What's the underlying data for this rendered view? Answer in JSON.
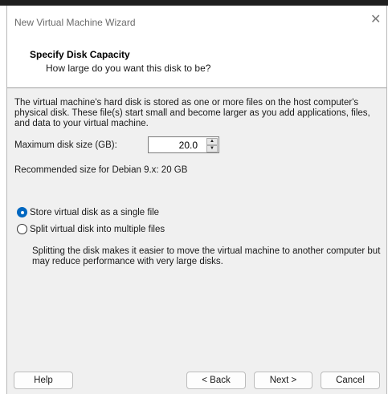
{
  "window": {
    "title": "New Virtual Machine Wizard",
    "close_glyph": "✕"
  },
  "header": {
    "title": "Specify Disk Capacity",
    "subtitle": "How large do you want this disk to be?"
  },
  "content": {
    "description": "The virtual machine's hard disk is stored as one or more files on the host computer's physical disk. These file(s) start small and become larger as you add applications, files, and data to your virtual machine.",
    "max_size_label": "Maximum disk size (GB):",
    "max_size_value": "20.0",
    "recommended": "Recommended size for Debian 9.x: 20 GB",
    "options": [
      {
        "label": "Store virtual disk as a single file",
        "selected": true
      },
      {
        "label": "Split virtual disk into multiple files",
        "selected": false
      }
    ],
    "split_description": "Splitting the disk makes it easier to move the virtual machine to another computer but may reduce performance with very large disks."
  },
  "buttons": {
    "help": "Help",
    "back": "< Back",
    "next": "Next >",
    "cancel": "Cancel"
  },
  "icons": {
    "spin_up": "spin-up-arrow-icon",
    "spin_down": "spin-down-arrow-icon",
    "close": "close-icon"
  },
  "colors": {
    "accent": "#0067c0",
    "dialog_bg": "#f0f0f0",
    "header_bg": "#ffffff"
  }
}
